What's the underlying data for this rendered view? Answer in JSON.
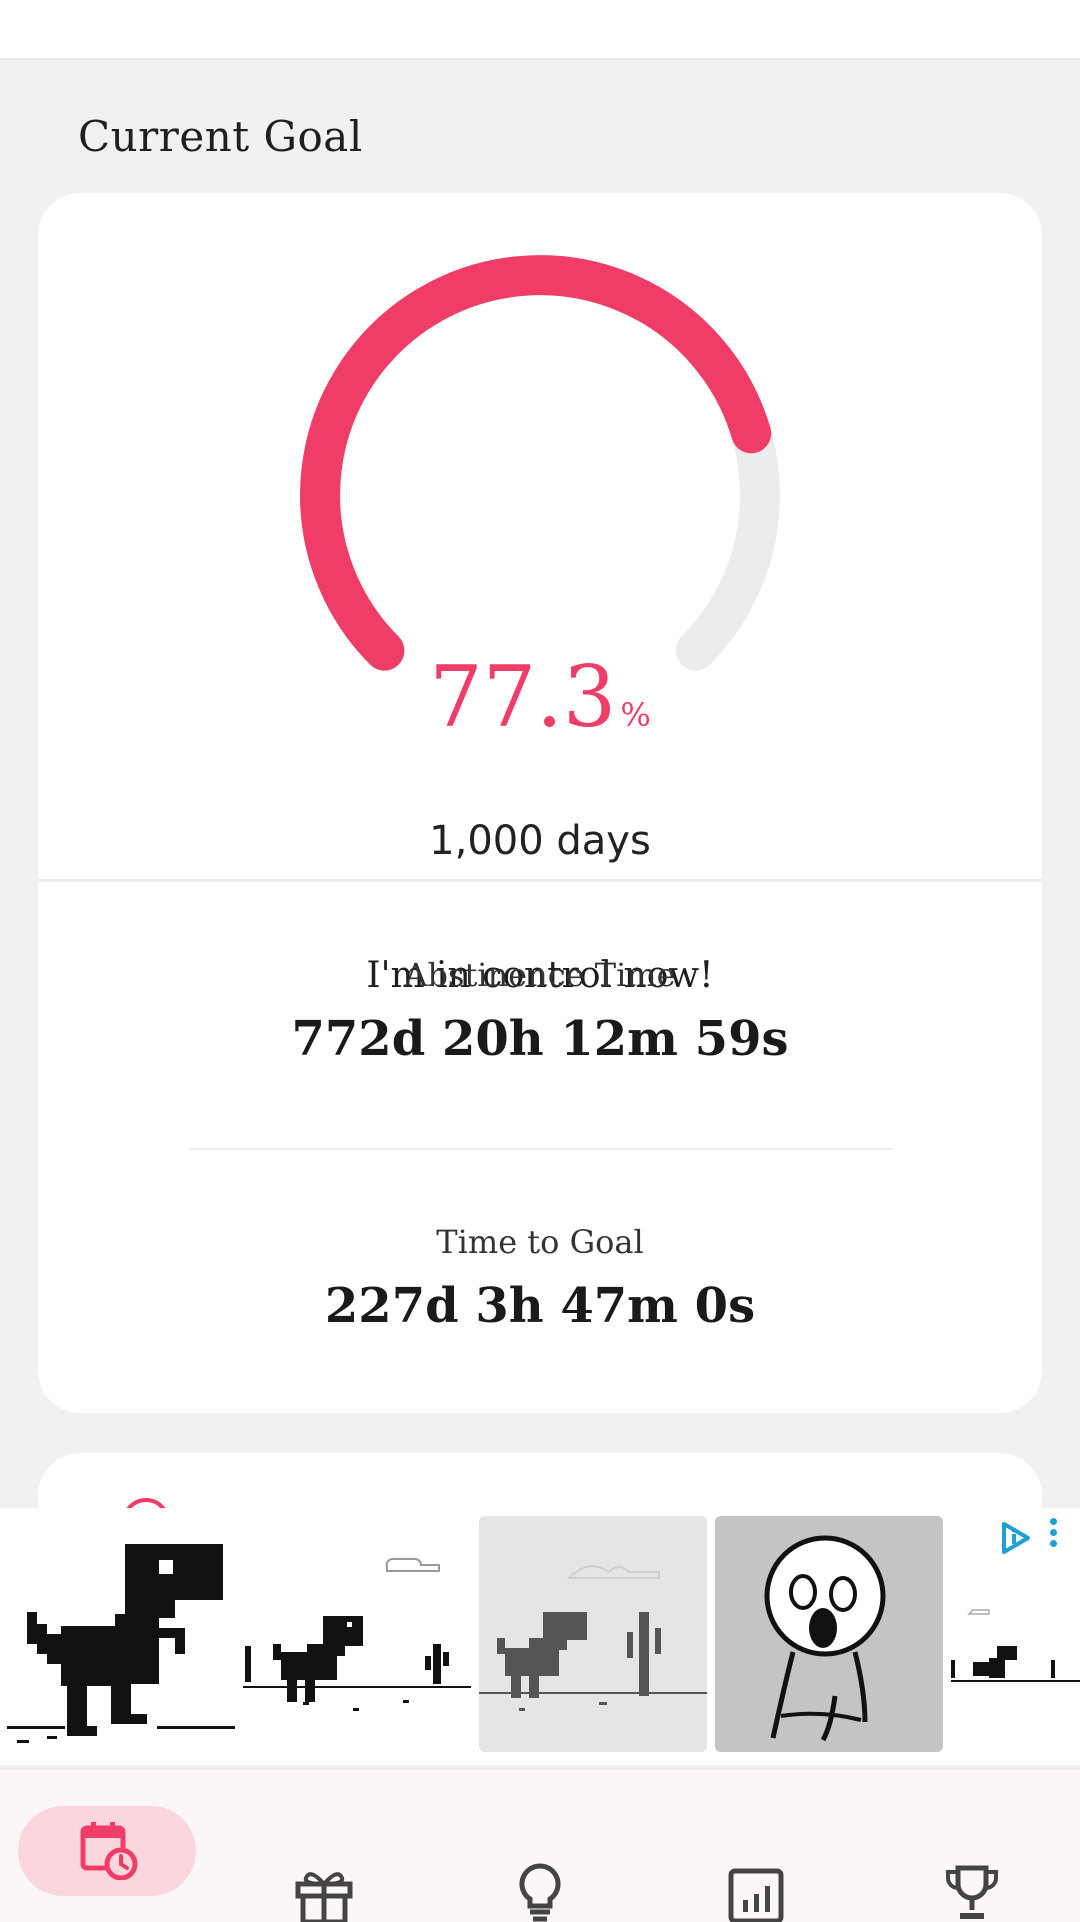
{
  "header": {
    "title": ""
  },
  "current_goal": {
    "section_title": "Current Goal",
    "progress_percent": 77.3,
    "percent_value": "77.3",
    "percent_unit": "%",
    "goal_days": "1,000 days",
    "motto": "I'm in control now!"
  },
  "stats": {
    "abstinence_label": "Abstinence Time",
    "abstinence_value": "772d 20h 12m 59s",
    "time_to_goal_label": "Time to Goal",
    "time_to_goal_value": "227d 3h 47m 0s"
  },
  "ad": {
    "tiles": [
      "dino-large",
      "dino-runner",
      "dino-runner-gray",
      "meme-face",
      "dino-small"
    ]
  },
  "bottom_nav": {
    "items": [
      {
        "icon": "calendar-clock-icon",
        "active": true
      },
      {
        "icon": "gift-icon",
        "active": false
      },
      {
        "icon": "lightbulb-icon",
        "active": false
      },
      {
        "icon": "bar-chart-icon",
        "active": false
      },
      {
        "icon": "trophy-icon",
        "active": false
      }
    ]
  },
  "colors": {
    "accent": "#ef3d67",
    "track": "#ececec",
    "nav_active_bg": "#fcd6df",
    "page_bg": "#f1f1f3"
  }
}
